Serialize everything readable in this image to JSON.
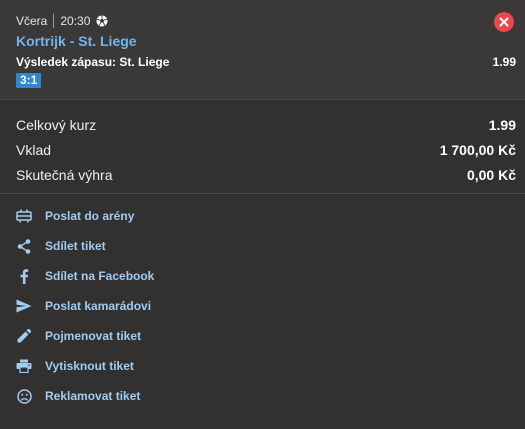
{
  "bet": {
    "day": "Včera",
    "time": "20:30",
    "sport_icon": "soccer-ball-icon",
    "match": "Kortrijk - St. Liege",
    "market": "Výsledek zápasu: St. Liege",
    "odds": "1.99",
    "score": "3:1"
  },
  "summary": {
    "total_odds_label": "Celkový kurz",
    "total_odds_value": "1.99",
    "stake_label": "Vklad",
    "stake_value": "1 700,00 Kč",
    "win_label": "Skutečná výhra",
    "win_value": "0,00 Kč"
  },
  "actions": [
    {
      "label": "Poslat do arény",
      "icon": "arena-icon"
    },
    {
      "label": "Sdílet tiket",
      "icon": "share-icon"
    },
    {
      "label": "Sdílet na Facebook",
      "icon": "facebook-icon"
    },
    {
      "label": "Poslat kamarádovi",
      "icon": "send-icon"
    },
    {
      "label": "Pojmenovat tiket",
      "icon": "pencil-icon"
    },
    {
      "label": "Vytisknout tiket",
      "icon": "printer-icon"
    },
    {
      "label": "Reklamovat tiket",
      "icon": "sad-face-icon"
    }
  ],
  "colors": {
    "background": "#333130",
    "card": "#3b3937",
    "link": "#9fcdf2",
    "match_link": "#6fb6f0",
    "badge": "#2e86d6",
    "close": "#e8474c"
  }
}
